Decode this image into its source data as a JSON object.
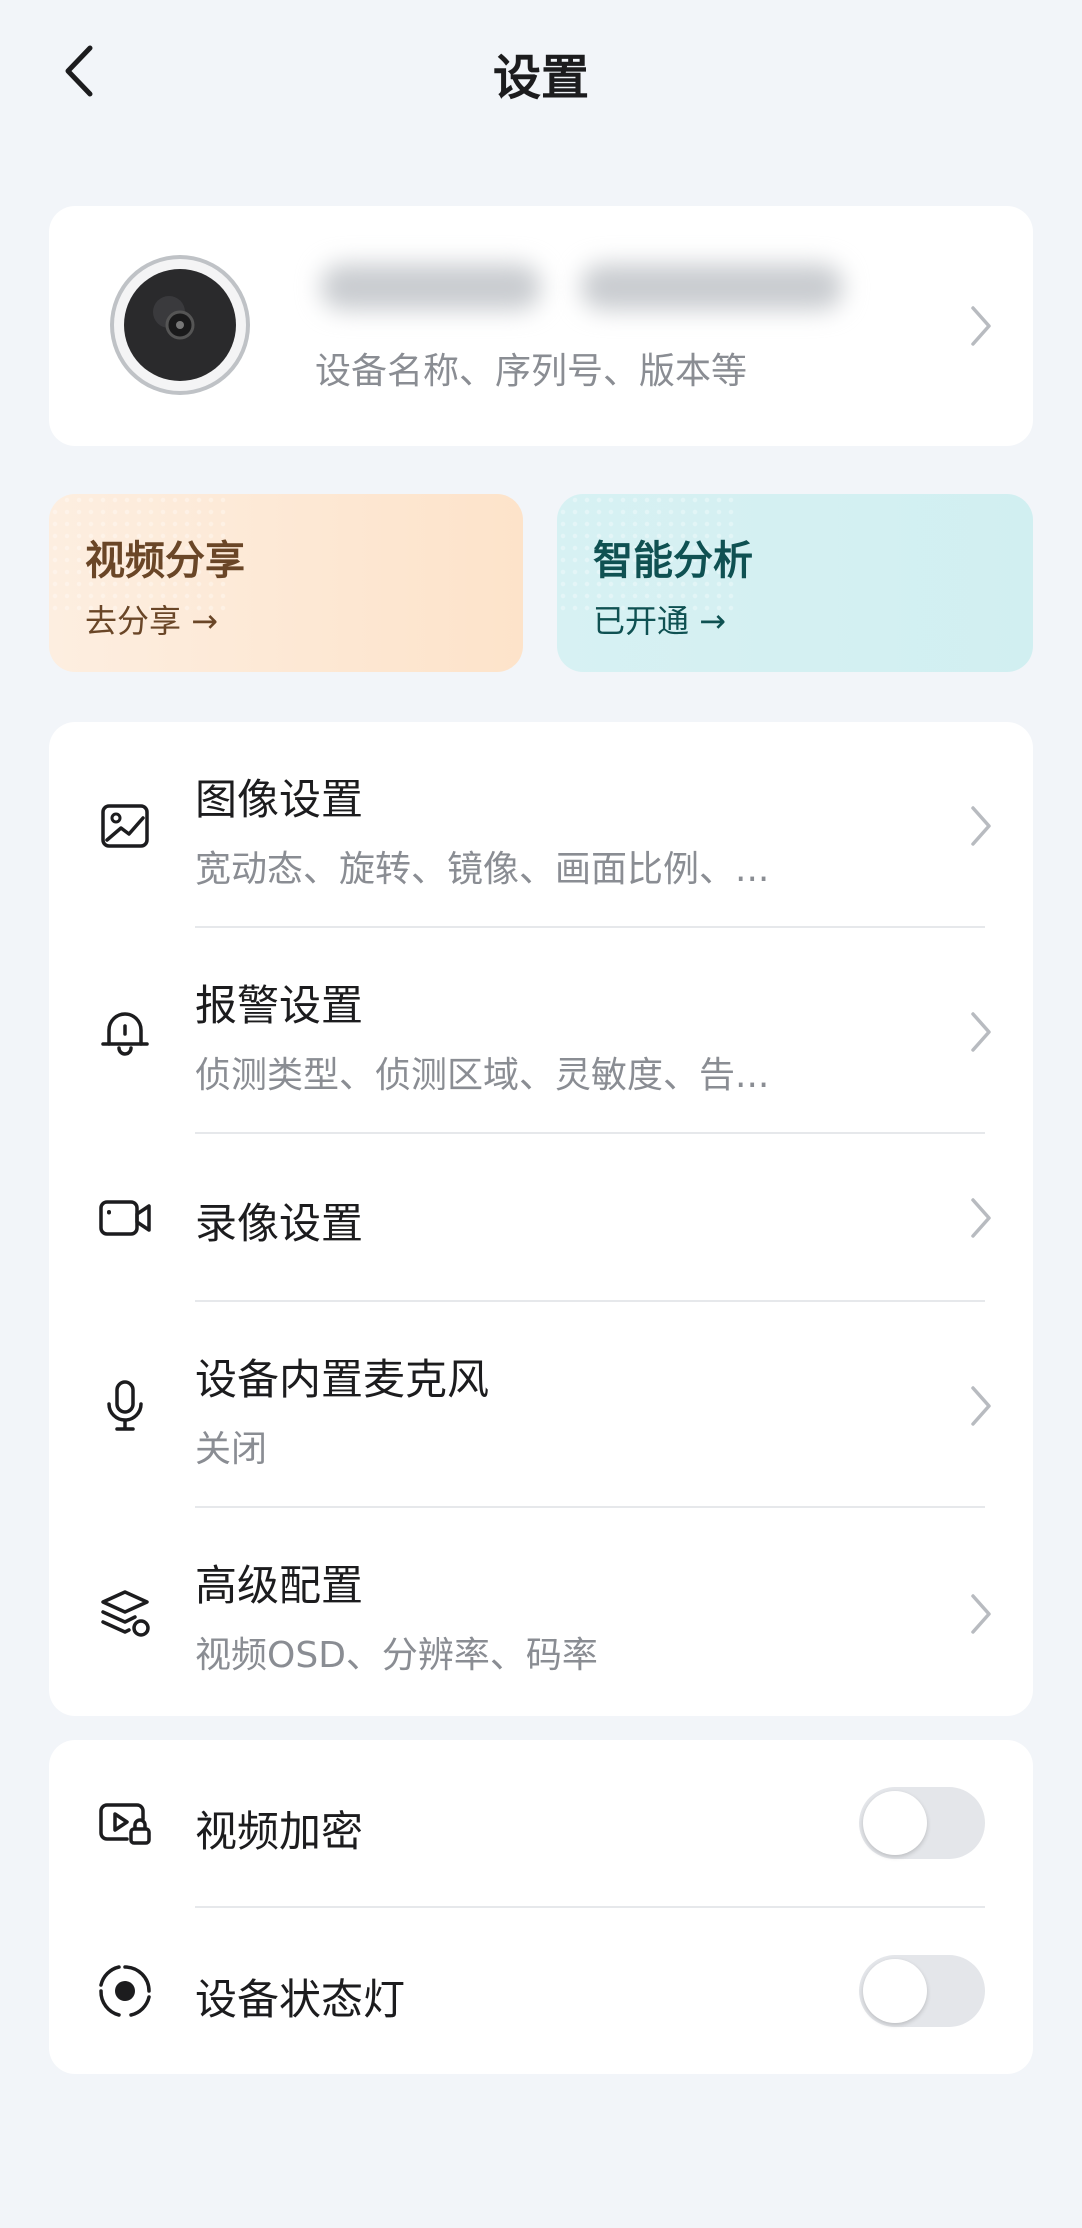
{
  "header": {
    "title": "设置",
    "back_icon": "chevron-left-icon"
  },
  "device": {
    "name": "",
    "subtitle": "设备名称、序列号、版本等"
  },
  "promos": [
    {
      "title": "视频分享",
      "action": "去分享 →"
    },
    {
      "title": "智能分析",
      "action": "已开通 →"
    }
  ],
  "settings": [
    {
      "icon": "image-icon",
      "title": "图像设置",
      "subtitle": "宽动态、旋转、镜像、画面比例、..."
    },
    {
      "icon": "alarm-bell-icon",
      "title": "报警设置",
      "subtitle": "侦测类型、侦测区域、灵敏度、告..."
    },
    {
      "icon": "video-camera-icon",
      "title": "录像设置",
      "subtitle": ""
    },
    {
      "icon": "microphone-icon",
      "title": "设备内置麦克风",
      "subtitle": "关闭"
    },
    {
      "icon": "layers-gear-icon",
      "title": "高级配置",
      "subtitle": "视频OSD、分辨率、码率"
    }
  ],
  "toggles": [
    {
      "icon": "video-lock-icon",
      "title": "视频加密",
      "on": false
    },
    {
      "icon": "status-light-icon",
      "title": "设备状态灯",
      "on": false
    }
  ],
  "colors": {
    "background": "#f2f5f9",
    "card": "#ffffff",
    "toggle_off": "#e4e6ea",
    "share_accent": "#6a4627",
    "ai_accent": "#0f5152"
  }
}
